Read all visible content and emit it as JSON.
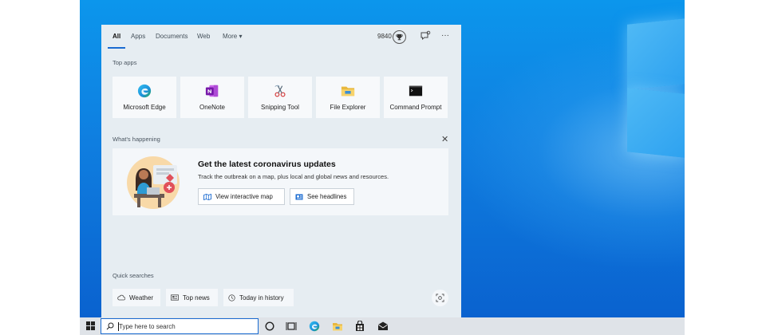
{
  "tabs": [
    {
      "label": "All",
      "active": true
    },
    {
      "label": "Apps",
      "active": false
    },
    {
      "label": "Documents",
      "active": false
    },
    {
      "label": "Web",
      "active": false
    },
    {
      "label": "More",
      "active": false
    }
  ],
  "more_caret": "▾",
  "rewards_points": "9840",
  "more_options": "···",
  "top_apps": {
    "label": "Top apps",
    "items": [
      {
        "label": "Microsoft Edge",
        "icon": "edge-icon"
      },
      {
        "label": "OneNote",
        "icon": "onenote-icon"
      },
      {
        "label": "Snipping Tool",
        "icon": "snipping-tool-icon"
      },
      {
        "label": "File Explorer",
        "icon": "file-explorer-icon"
      },
      {
        "label": "Command Prompt",
        "icon": "command-prompt-icon"
      }
    ]
  },
  "whats_happening": {
    "label": "What's happening",
    "close": "✕",
    "card": {
      "title": "Get the latest coronavirus updates",
      "description": "Track the outbreak on a map, plus local and global news and resources.",
      "buttons": [
        {
          "label": "View interactive map",
          "icon": "map-icon"
        },
        {
          "label": "See headlines",
          "icon": "news-icon"
        }
      ]
    }
  },
  "quick_searches": {
    "label": "Quick searches",
    "items": [
      {
        "label": "Weather",
        "icon": "cloud-icon"
      },
      {
        "label": "Top news",
        "icon": "newspaper-icon"
      },
      {
        "label": "Today in history",
        "icon": "clock-icon"
      }
    ]
  },
  "taskbar": {
    "search_placeholder": "Type here to search"
  },
  "colors": {
    "accent": "#1a6bd1",
    "desktop_blue": "#0f7ee0",
    "panel_bg": "#e6edf2",
    "taskbar_bg": "#dfe3e8"
  }
}
